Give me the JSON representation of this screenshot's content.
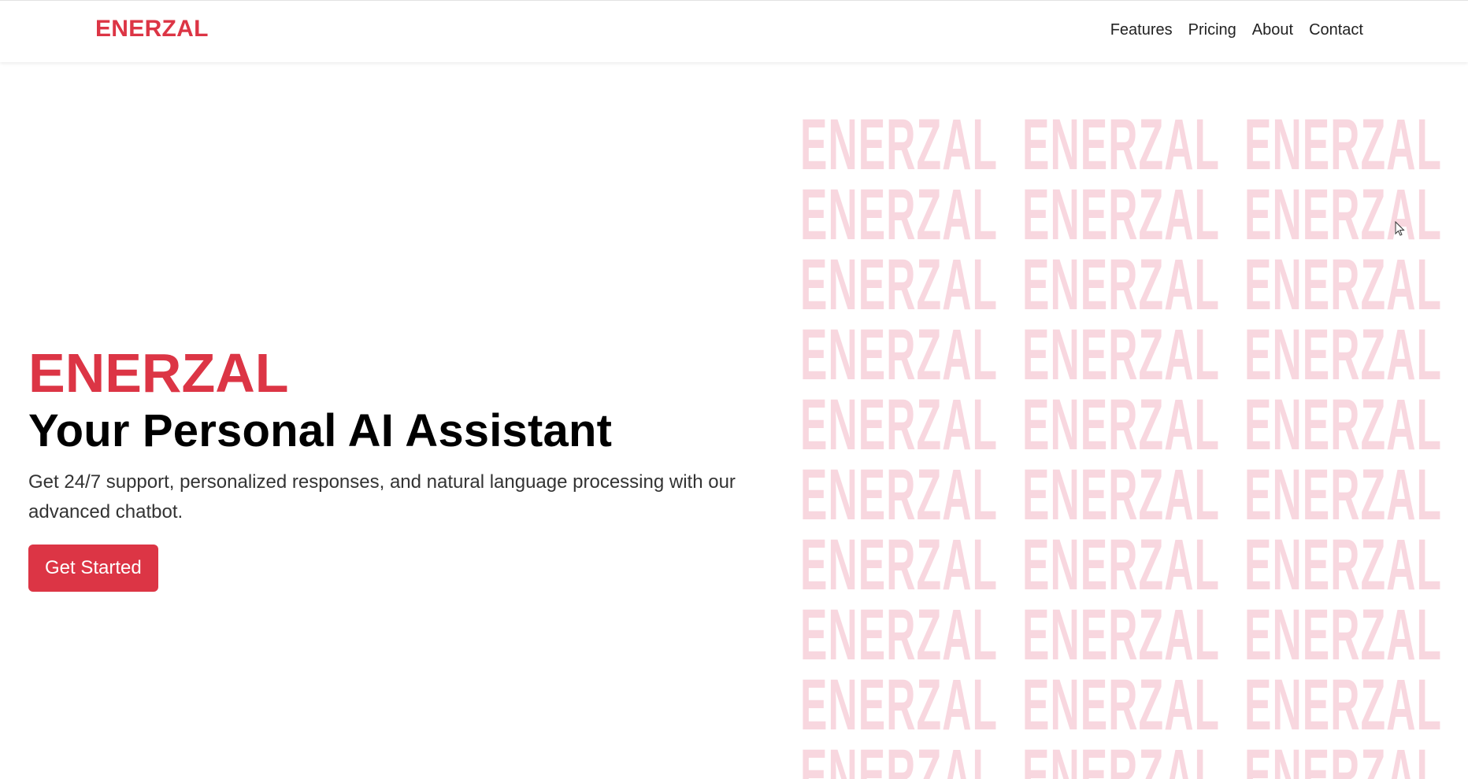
{
  "navbar": {
    "brand": "ENERZAL",
    "links": [
      "Features",
      "Pricing",
      "About",
      "Contact"
    ]
  },
  "hero": {
    "brand": "ENERZAL",
    "title": "Your Personal AI Assistant",
    "subtitle": "Get 24/7 support, personalized responses, and natural language processing with our advanced chatbot.",
    "cta_label": "Get Started"
  },
  "pattern": {
    "word": "ENERZAL",
    "rows": 10,
    "columns": 3
  },
  "colors": {
    "accent": "#dc3545",
    "pattern": "#f8d7df",
    "title": "#000000"
  },
  "icons": {
    "cursor": "mouse-pointer-icon"
  }
}
